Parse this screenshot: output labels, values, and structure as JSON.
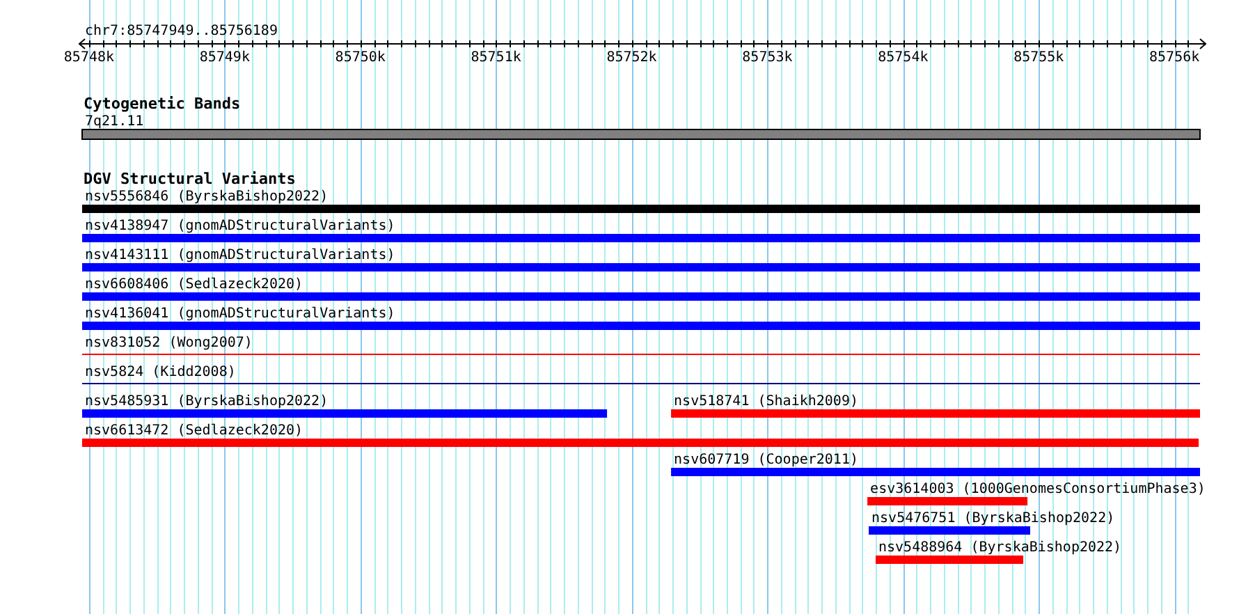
{
  "ruler": {
    "title": "chr7:85747949..85756189",
    "ticks": [
      "85748k",
      "85749k",
      "85750k",
      "85751k",
      "85752k",
      "85753k",
      "85754k",
      "85755k",
      "85756k"
    ]
  },
  "cytobands": {
    "title": "Cytogenetic Bands",
    "band": {
      "label": "7q21.11",
      "color": "#808080"
    }
  },
  "variants": {
    "title": "DGV Structural Variants",
    "features": [
      {
        "label": "nsv5556846 (ByrskaBishop2022)",
        "kind": "bar",
        "color": "#000000"
      },
      {
        "label": "nsv4138947 (gnomADStructuralVariants)",
        "kind": "bar",
        "color": "#0000ff"
      },
      {
        "label": "nsv4143111 (gnomADStructuralVariants)",
        "kind": "bar",
        "color": "#0000ff"
      },
      {
        "label": "nsv6608406 (Sedlazeck2020)",
        "kind": "bar",
        "color": "#0000ff"
      },
      {
        "label": "nsv4136041 (gnomADStructuralVariants)",
        "kind": "bar",
        "color": "#0000ff"
      },
      {
        "label": "nsv831052 (Wong2007)",
        "kind": "line",
        "color": "#ff0000"
      },
      {
        "label": "nsv5824 (Kidd2008)",
        "kind": "line",
        "color": "#000080"
      },
      {
        "label": "nsv5485931 (ByrskaBishop2022)",
        "kind": "bar",
        "color": "#0000ff"
      },
      {
        "label": "nsv518741 (Shaikh2009)",
        "kind": "bar",
        "color": "#ff0000"
      },
      {
        "label": "nsv6613472 (Sedlazeck2020)",
        "kind": "bar",
        "color": "#ff0000"
      },
      {
        "label": "nsv607719 (Cooper2011)",
        "kind": "bar",
        "color": "#0000ff"
      },
      {
        "label": "esv3614003 (1000GenomesConsortiumPhase3)",
        "kind": "bar",
        "color": "#ff0000"
      },
      {
        "label": "nsv5476751 (ByrskaBishop2022)",
        "kind": "bar",
        "color": "#0000ff"
      },
      {
        "label": "nsv5488964 (ByrskaBishop2022)",
        "kind": "bar",
        "color": "#ff0000"
      }
    ]
  }
}
